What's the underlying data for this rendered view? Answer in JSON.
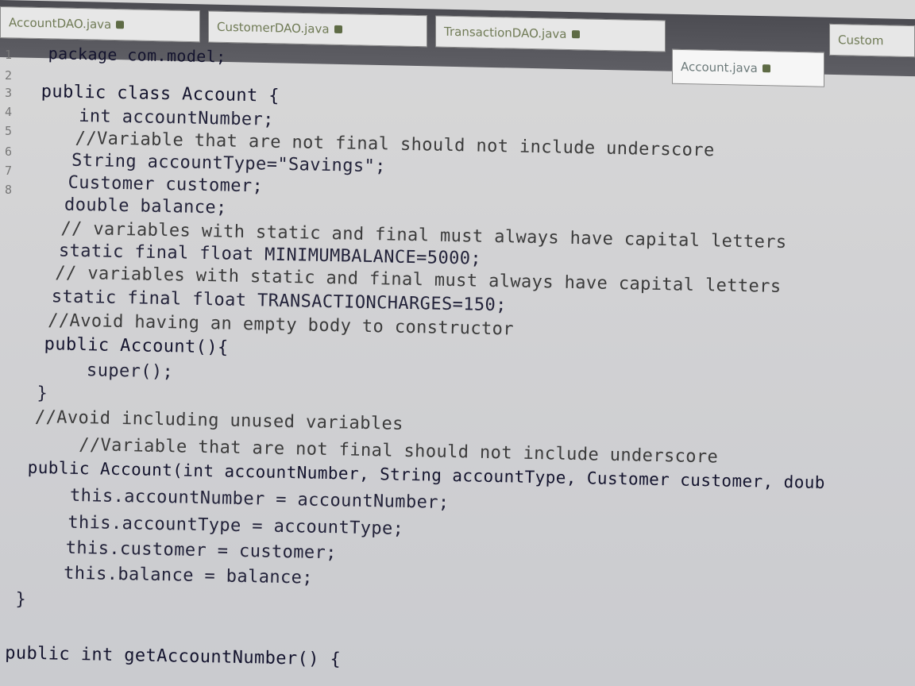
{
  "tabs": [
    {
      "label": "AccountDAO.java"
    },
    {
      "label": "CustomerDAO.java"
    },
    {
      "label": "TransactionDAO.java"
    },
    {
      "label": "Account.java"
    },
    {
      "label": "Custom"
    }
  ],
  "gutter": [
    "1",
    "2",
    "3",
    "4",
    "5",
    "6",
    "7",
    "8"
  ],
  "code": [
    "package com.model;",
    "public class Account {",
    "int accountNumber;",
    "//Variable that are not final should not include underscore",
    "String accountType=\"Savings\";",
    "Customer customer;",
    "double balance;",
    "// variables with static and final must always have capital letters",
    "static final float MINIMUMBALANCE=5000;",
    "// variables with static and final must always have capital letters",
    "static final float TRANSACTIONCHARGES=150;",
    "//Avoid having an empty body to constructor",
    "public Account(){",
    "super();",
    "}",
    "//Avoid including unused variables",
    "//Variable that are not final should not include underscore",
    "public Account(int accountNumber, String accountType, Customer customer, doub",
    "this.accountNumber = accountNumber;",
    "this.accountType = accountType;",
    "this.customer = customer;",
    "this.balance = balance;",
    "}",
    "public int getAccountNumber() {"
  ]
}
